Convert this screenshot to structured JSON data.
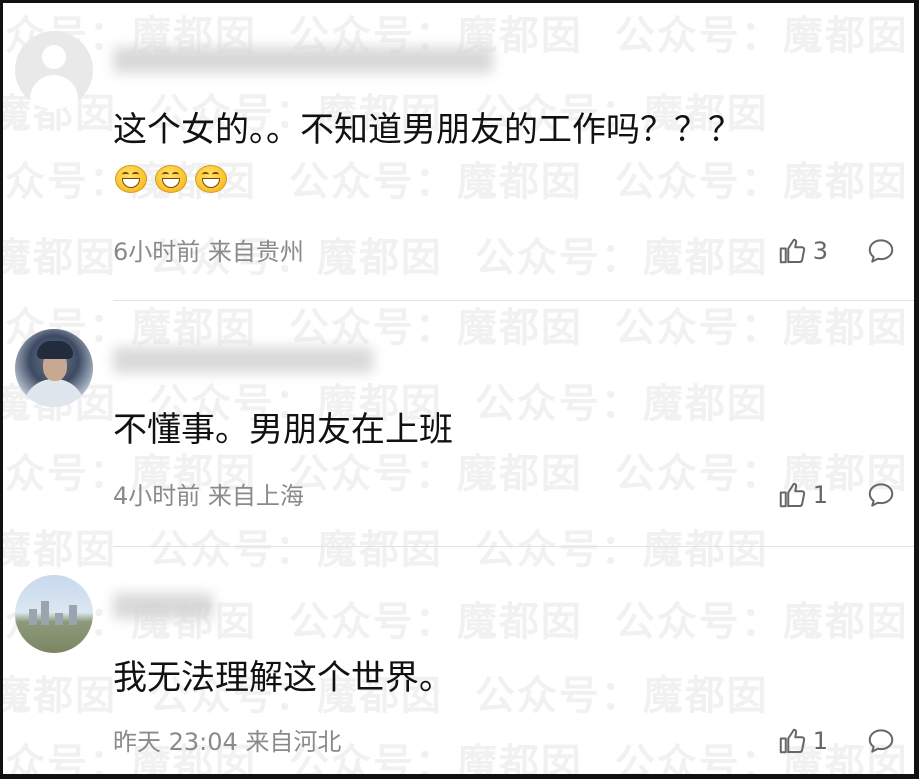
{
  "watermark": {
    "text": "公众号：魔都囡"
  },
  "comments": [
    {
      "text": "这个女的。。不知道男朋友的工作吗？？？",
      "emojis": [
        "😅",
        "😅",
        "😅"
      ],
      "time": "6小时前",
      "location": "来自贵州",
      "likes": "3"
    },
    {
      "text": "不懂事。男朋友在上班",
      "time": "4小时前",
      "location": "来自上海",
      "likes": "1"
    },
    {
      "text": "我无法理解这个世界。",
      "time": "昨天 23:04",
      "location": "来自河北",
      "likes": "1"
    }
  ],
  "icons": {
    "like": "thumbs-up-icon",
    "reply": "comment-bubble-icon"
  }
}
